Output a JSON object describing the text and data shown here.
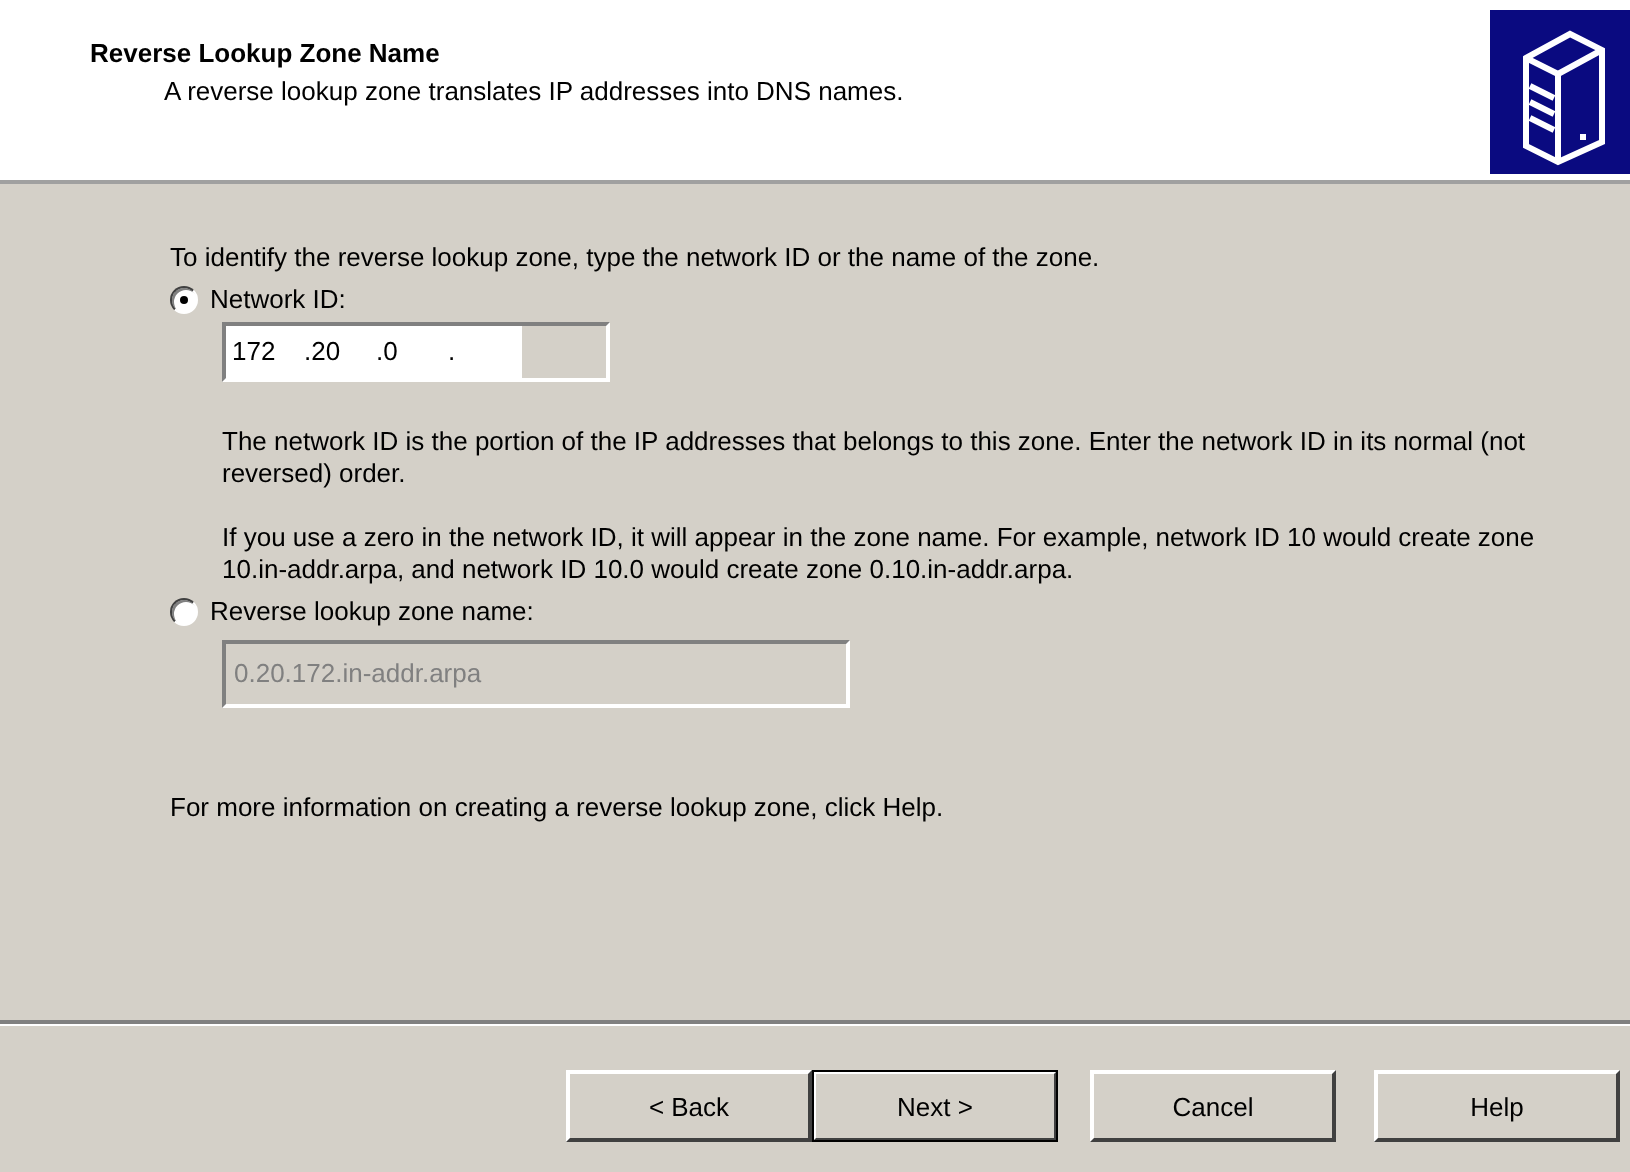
{
  "header": {
    "title": "Reverse Lookup Zone Name",
    "subtitle": "A reverse lookup zone translates IP addresses into DNS names."
  },
  "intro": "To identify the reverse lookup zone, type the network ID or the name of the zone.",
  "options": [
    {
      "kind": "ip",
      "label": "Network ID:",
      "selected": true,
      "octets": [
        "172",
        ".20",
        ".0",
        "."
      ],
      "notes": [
        "The network ID is the portion of the IP addresses that belongs to this zone. Enter the network ID in its normal (not reversed) order.",
        "If you use a zero in the network ID, it will appear in the zone name. For example, network ID 10 would create zone 10.in-addr.arpa, and network ID 10.0 would create zone 0.10.in-addr.arpa."
      ]
    },
    {
      "kind": "name",
      "label": "Reverse lookup zone name:",
      "selected": false,
      "value": "0.20.172.in-addr.arpa",
      "disabled": true
    }
  ],
  "footer_note": "For more information on creating a reverse lookup zone, click Help.",
  "buttons": [
    {
      "label": "< Back",
      "default": false
    },
    {
      "label": "Next >",
      "default": true
    },
    {
      "label": "Cancel",
      "default": false
    },
    {
      "label": "Help",
      "default": false
    }
  ]
}
